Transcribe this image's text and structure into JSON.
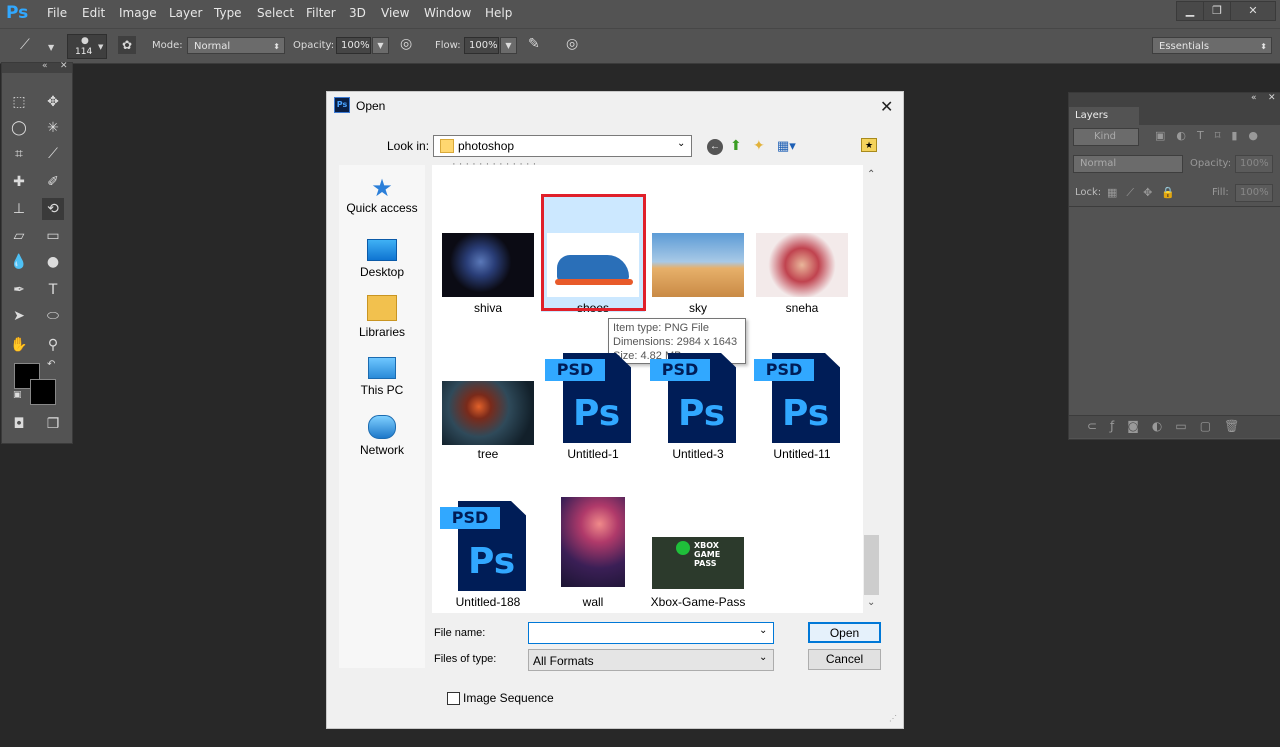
{
  "app": {
    "logo": "Ps"
  },
  "menu": [
    "File",
    "Edit",
    "Image",
    "Layer",
    "Type",
    "Select",
    "Filter",
    "3D",
    "View",
    "Window",
    "Help"
  ],
  "window_controls": {
    "minimize": "▁",
    "restore": "❐",
    "close": "✕"
  },
  "options": {
    "brush_size": "114",
    "mode_label": "Mode:",
    "mode_value": "Normal",
    "opacity_label": "Opacity:",
    "opacity_value": "100%",
    "flow_label": "Flow:",
    "flow_value": "100%",
    "workspace": "Essentials"
  },
  "layers_panel": {
    "tab": "Layers",
    "kind": "Kind",
    "blend": "Normal",
    "opacity_label": "Opacity:",
    "opacity_value": "100%",
    "lock_label": "Lock:",
    "fill_label": "Fill:",
    "fill_value": "100%"
  },
  "dialog": {
    "title": "Open",
    "look_in_label": "Look in:",
    "look_in_value": "photoshop",
    "places": [
      "Quick access",
      "Desktop",
      "Libraries",
      "This PC",
      "Network"
    ],
    "files": [
      {
        "name": "shiva",
        "kind": "image"
      },
      {
        "name": "shoes",
        "kind": "image",
        "selected": true
      },
      {
        "name": "sky",
        "kind": "image"
      },
      {
        "name": "sneha",
        "kind": "image"
      },
      {
        "name": "tree",
        "kind": "image"
      },
      {
        "name": "Untitled-1",
        "kind": "psd"
      },
      {
        "name": "Untitled-3",
        "kind": "psd"
      },
      {
        "name": "Untitled-11",
        "kind": "psd"
      },
      {
        "name": "Untitled-188",
        "kind": "psd"
      },
      {
        "name": "wall",
        "kind": "image"
      },
      {
        "name": "Xbox-Game-Pass",
        "kind": "image"
      }
    ],
    "psd_badge": "PSD",
    "psd_logo": "Ps",
    "xbox_text": "XBOX GAME PASS",
    "tooltip": {
      "type": "Item type: PNG File",
      "dimensions": "Dimensions: 2984 x 1643",
      "size": "Size: 4.82 MB"
    },
    "file_name_label": "File name:",
    "file_name_value": "",
    "file_type_label": "Files of type:",
    "file_type_value": "All Formats",
    "open_button": "Open",
    "cancel_button": "Cancel",
    "image_sequence_label": "Image Sequence",
    "highlight_color": "#e0202a"
  }
}
